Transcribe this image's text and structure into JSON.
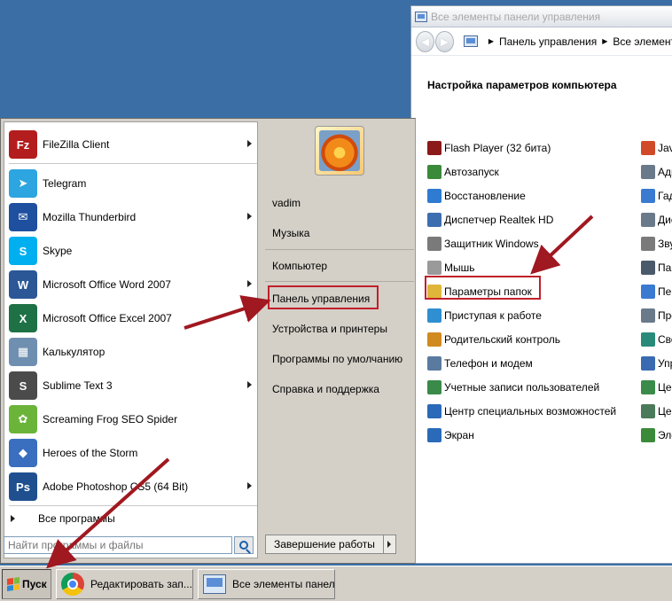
{
  "control_panel": {
    "window_title": "Все элементы панели управления",
    "address": [
      "Панель управления",
      "Все элемент"
    ],
    "heading": "Настройка параметров компьютера",
    "items": [
      {
        "label": "Flash Player (32 бита)",
        "icon": "flash-icon",
        "color": "#8b1a1a"
      },
      {
        "label": "Автозапуск",
        "icon": "autoplay-icon",
        "color": "#3a8a3a"
      },
      {
        "label": "Восстановление",
        "icon": "recovery-icon",
        "color": "#2f7bd1"
      },
      {
        "label": "Диспетчер Realtek HD",
        "icon": "realtek-icon",
        "color": "#3d6fb0"
      },
      {
        "label": "Защитник Windows",
        "icon": "defender-icon",
        "color": "#7a7a7a"
      },
      {
        "label": "Мышь",
        "icon": "mouse-icon",
        "color": "#9a9a9a"
      },
      {
        "label": "Параметры папок",
        "icon": "folder-options-icon",
        "color": "#e0b63a"
      },
      {
        "label": "Приступая к работе",
        "icon": "getting-started-icon",
        "color": "#2f8fd1"
      },
      {
        "label": "Родительский контроль",
        "icon": "parental-control-icon",
        "color": "#d08a20"
      },
      {
        "label": "Телефон и модем",
        "icon": "phone-modem-icon",
        "color": "#5a7aa0"
      },
      {
        "label": "Учетные записи пользователей",
        "icon": "user-accounts-icon",
        "color": "#3a8a4a"
      },
      {
        "label": "Центр специальных возможностей",
        "icon": "ease-of-access-icon",
        "color": "#2a6ab8"
      },
      {
        "label": "Экран",
        "icon": "display-icon",
        "color": "#2a6ab8"
      }
    ],
    "items_col2": [
      {
        "label": "Jav",
        "icon": "java-icon",
        "color": "#d04a2a"
      },
      {
        "label": "Адм",
        "icon": "admin-tools-icon",
        "color": "#6a7a8a"
      },
      {
        "label": "Гад",
        "icon": "gadgets-icon",
        "color": "#3a7ad0"
      },
      {
        "label": "Дис",
        "icon": "device-manager-icon",
        "color": "#6a7a8a"
      },
      {
        "label": "Зву",
        "icon": "sound-icon",
        "color": "#7a7a7a"
      },
      {
        "label": "Пан",
        "icon": "taskbar-icon",
        "color": "#4a5a6a"
      },
      {
        "label": "Пер",
        "icon": "personalization-icon",
        "color": "#3a7ad0"
      },
      {
        "label": "Про",
        "icon": "programs-icon",
        "color": "#6a7a8a"
      },
      {
        "label": "Сво",
        "icon": "region-icon",
        "color": "#2a8a7a"
      },
      {
        "label": "Упр",
        "icon": "credential-icon",
        "color": "#3a6ab0"
      },
      {
        "label": "Цен",
        "icon": "action-center-icon",
        "color": "#3a8a4a"
      },
      {
        "label": "Цен",
        "icon": "sync-center-icon",
        "color": "#4a7a5a"
      },
      {
        "label": "Эле",
        "icon": "power-icon",
        "color": "#3a8a3a"
      }
    ]
  },
  "start_menu": {
    "programs": [
      {
        "label": "FileZilla Client",
        "icon": "filezilla-icon",
        "glyph": "Fz",
        "color": "#b31d1d",
        "has_arrow": true
      },
      {
        "label": "Telegram",
        "icon": "telegram-icon",
        "glyph": "➤",
        "color": "#2ca5e0",
        "has_arrow": false
      },
      {
        "label": "Mozilla Thunderbird",
        "icon": "thunderbird-icon",
        "glyph": "✉",
        "color": "#1f4f9f",
        "has_arrow": true
      },
      {
        "label": "Skype",
        "icon": "skype-icon",
        "glyph": "S",
        "color": "#00aff0",
        "has_arrow": false
      },
      {
        "label": "Microsoft Office Word 2007",
        "icon": "word-icon",
        "glyph": "W",
        "color": "#2b5797",
        "has_arrow": true
      },
      {
        "label": "Microsoft Office Excel 2007",
        "icon": "excel-icon",
        "glyph": "X",
        "color": "#1e7145",
        "has_arrow": true
      },
      {
        "label": "Калькулятор",
        "icon": "calculator-icon",
        "glyph": "▦",
        "color": "#6f8fb0",
        "has_arrow": false
      },
      {
        "label": "Sublime Text 3",
        "icon": "sublime-icon",
        "glyph": "S",
        "color": "#4b4b4b",
        "has_arrow": true
      },
      {
        "label": "Screaming Frog SEO Spider",
        "icon": "screaming-frog-icon",
        "glyph": "✿",
        "color": "#6bb43a",
        "has_arrow": false
      },
      {
        "label": "Heroes of the Storm",
        "icon": "heroes-storm-icon",
        "glyph": "◆",
        "color": "#3a6fbf",
        "has_arrow": false
      },
      {
        "label": "Adobe Photoshop CS5 (64 Bit)",
        "icon": "photoshop-icon",
        "glyph": "Ps",
        "color": "#1f4f8f",
        "has_arrow": true
      }
    ],
    "all_programs": "Все программы",
    "search_placeholder": "Найти программы и файлы",
    "right": {
      "user": "vadim",
      "music": "Музыка",
      "computer": "Компьютер",
      "control_panel": "Панель управления",
      "devices": "Устройства и принтеры",
      "default_programs": "Программы по умолчанию",
      "help": "Справка и поддержка"
    },
    "shutdown": "Завершение работы"
  },
  "taskbar": {
    "start": "Пуск",
    "tasks": [
      {
        "label": "Редактировать зап...",
        "icon": "chrome-icon"
      },
      {
        "label": "Все элементы панел...",
        "icon": "control-panel-icon"
      }
    ]
  },
  "colors": {
    "desktop": "#3a6ea5",
    "highlight_box": "#c0202a",
    "arrow": "#a01820"
  }
}
